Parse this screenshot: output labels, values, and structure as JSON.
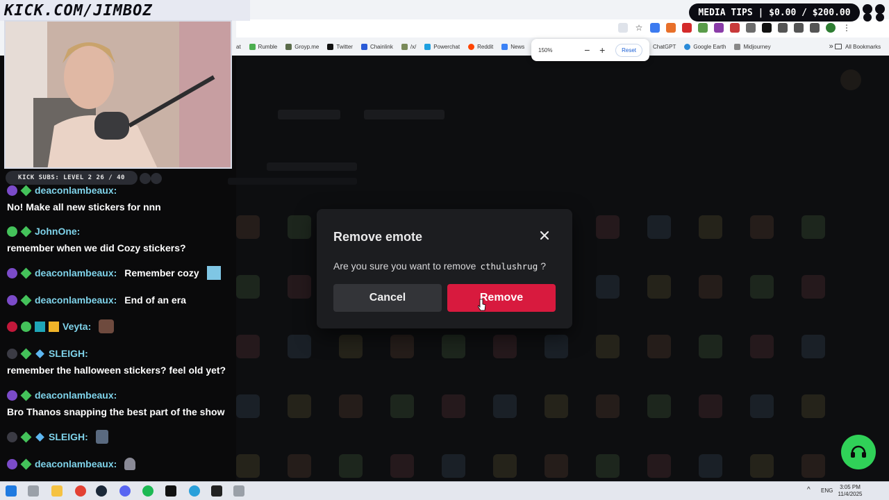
{
  "overlay": {
    "site_banner": "KICK.COM/JIMBOZ",
    "media_tips": "MEDIA TIPS | $0.00 / $200.00",
    "kick_subs": "KICK SUBS: LEVEL 2 26 / 40"
  },
  "browser": {
    "bookmarks": [
      "at",
      "Rumble",
      "Groyp.me",
      "Twitter",
      "Chainlink",
      "/x/",
      "Powerchat",
      "Reddit",
      "News"
    ],
    "bookmarks_right": [
      "ChatGPT",
      "Google Earth",
      "Midjourney"
    ],
    "all_bookmarks": "All Bookmarks",
    "zoom": {
      "value": "150%",
      "minus": "−",
      "plus": "+",
      "reset": "Reset"
    },
    "extensions": [
      "zoom-icon",
      "star-icon",
      "wave-icon",
      "fox-icon",
      "badge-icon",
      "doc-icon",
      "id-icon",
      "cat-icon",
      "s-icon",
      "x-icon",
      "puzzle-icon",
      "tab-icon",
      "menu-icon",
      "profile-icon",
      "more-icon"
    ]
  },
  "chat": {
    "messages": [
      {
        "user": "deaconlambeaux:",
        "text": "No! Make all new stickers for nnn",
        "inline": false
      },
      {
        "user": "JohnOne:",
        "text": "remember when we did Cozy stickers?",
        "inline": false
      },
      {
        "user": "deaconlambeaux:",
        "text": "Remember cozy",
        "inline": true
      },
      {
        "user": "deaconlambeaux:",
        "text": "End of an era",
        "inline": true
      },
      {
        "user": "Veyta:",
        "text": "",
        "inline": true
      },
      {
        "user": "SLEIGH:",
        "text": "remember the halloween stickers? feel old yet?",
        "inline": false
      },
      {
        "user": "deaconlambeaux:",
        "text": "Bro Thanos snapping the best part of the show",
        "inline": false
      },
      {
        "user": "SLEIGH:",
        "text": "",
        "inline": true
      },
      {
        "user": "deaconlambeaux:",
        "text": "",
        "inline": true
      }
    ]
  },
  "modal": {
    "title": "Remove emote",
    "prompt": "Are you sure you want to remove",
    "emote_name": "cthulushrug",
    "suffix": "?",
    "cancel_label": "Cancel",
    "remove_label": "Remove"
  },
  "taskbar": {
    "lang": "ENG",
    "time": "3:05 PM",
    "date": "11/4/2025"
  },
  "colors": {
    "accent_remove": "#d81a3e",
    "chat_username": "#7fd3ea",
    "support_bubble": "#30d158"
  }
}
